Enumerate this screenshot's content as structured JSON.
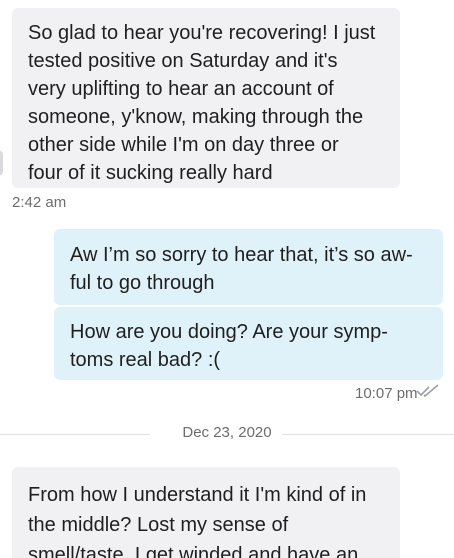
{
  "messages": [
    {
      "direction": "incoming",
      "text": "So glad to hear you're recovering! I just\ntested positive on Saturday and it's\nvery uplifting to hear an account of\nsomeone, y'know, making through the\nother side while I'm on day three or\nfour of it sucking really hard",
      "time": "2:42 am"
    },
    {
      "direction": "outgoing",
      "text": "Aw I’m so sorry to hear that, it’s so aw-\nful to go through"
    },
    {
      "direction": "outgoing",
      "text": "How are you doing? Are your symp-\ntoms real bad? :(",
      "time": "10:07 pm",
      "status_icon": "double-check-icon"
    },
    {
      "direction": "incoming",
      "text": "From how I understand it I'm kind of in\nthe middle? Lost my sense of\nsmell/taste, I get winded and have an"
    }
  ],
  "date_separator": "Dec 23, 2020",
  "colors": {
    "incoming_bubble": "#f1f1f3",
    "outgoing_bubble": "#dff2fa",
    "timestamp": "#6d6d6d",
    "check_icon": "#9aa0a6"
  }
}
